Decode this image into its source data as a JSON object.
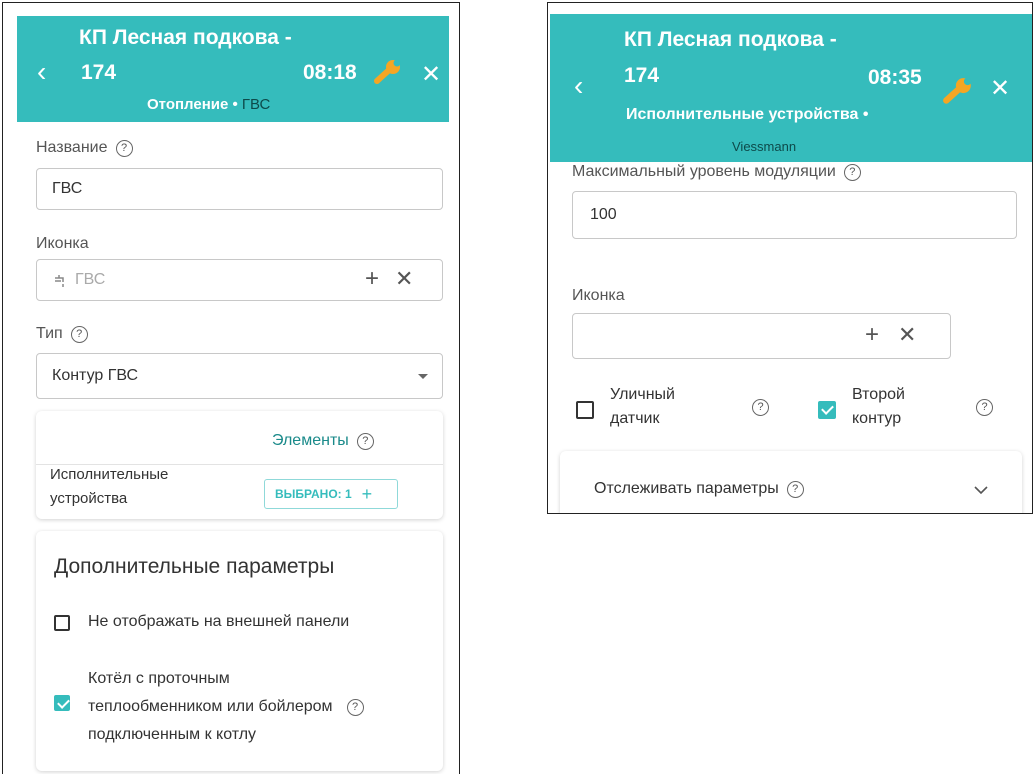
{
  "left": {
    "header": {
      "title": "КП Лесная подкова   -",
      "number": "174",
      "time": "08:18",
      "subtitle_prefix": "Отопление  •  ",
      "subtitle_active": "ГВС"
    },
    "name_field": {
      "label": "Название",
      "value": "ГВС"
    },
    "icon_field": {
      "label": "Иконка",
      "value": "ГВС",
      "icon": "faucet-icon"
    },
    "type_field": {
      "label": "Тип",
      "value": "Контур ГВС"
    },
    "elements_card": {
      "title": "Элементы",
      "row_label_1": "Исполнительные",
      "row_label_2": "устройства",
      "chip": "ВЫБРАНО: 1"
    },
    "extra_params": {
      "title": "Дополнительные параметры",
      "hide_on_panel": {
        "label": "Не отображать на внешней панели",
        "checked": false
      },
      "boiler": {
        "line1": "Котёл с проточным",
        "line2": "теплообменником или бойлером",
        "line3": "подключенным к котлу",
        "checked": true
      }
    }
  },
  "right": {
    "header": {
      "title": "КП Лесная подкова   -",
      "number": "174",
      "time": "08:35",
      "subtitle": "Исполнительные устройства  •",
      "subtitle2": "Viessmann"
    },
    "modulation_field": {
      "label": "Максимальный уровень модуляции",
      "value": "100"
    },
    "icon_field": {
      "label": "Иконка",
      "value": ""
    },
    "street_sensor": {
      "line1": "Уличный",
      "line2": "датчик",
      "checked": false
    },
    "second_circuit": {
      "line1": "Второй",
      "line2": "контур",
      "checked": true
    },
    "track_params": {
      "label": "Отслеживать параметры"
    }
  },
  "colors": {
    "accent": "#35bcbc",
    "wrench": "#f5a623"
  }
}
